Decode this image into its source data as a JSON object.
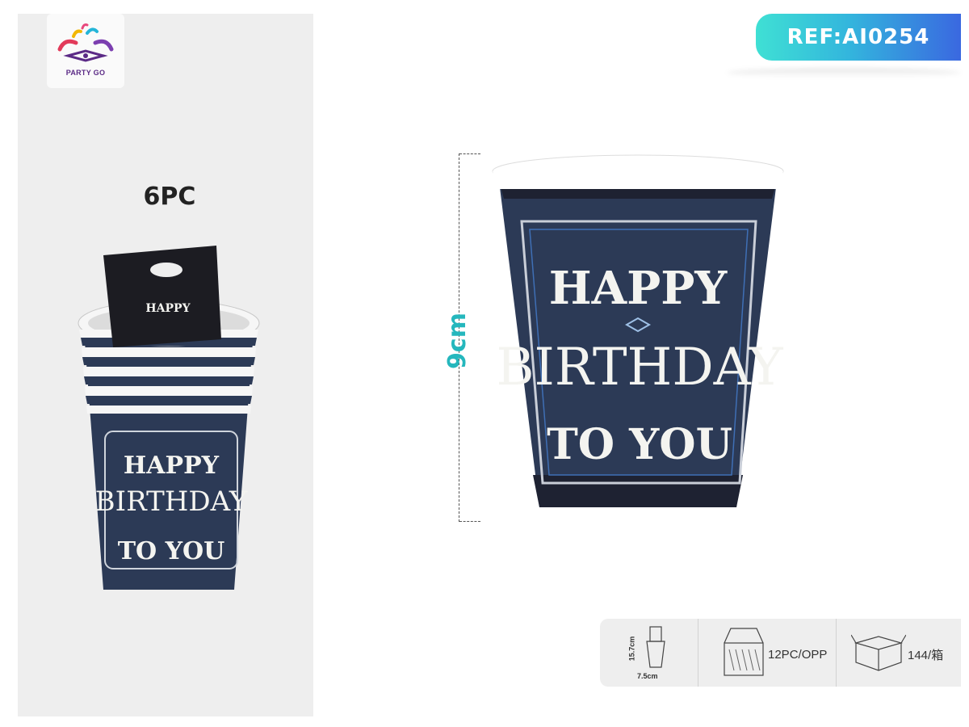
{
  "brand": {
    "logo_text": "PARTY GO"
  },
  "reference": {
    "label": "REF:AI0254"
  },
  "pack": {
    "count_label": "6PC"
  },
  "product": {
    "print_line1": "HAPPY",
    "print_line2": "BIRTHDAY",
    "print_line3": "TO YOU",
    "height_label": "9cm",
    "cup_color": "#2c3a56",
    "accent_color": "#25b7bd"
  },
  "specs": {
    "package_height": "15.7cm",
    "package_width": "7.5cm",
    "inner_pack": "12PC/OPP",
    "carton": "144/箱"
  }
}
